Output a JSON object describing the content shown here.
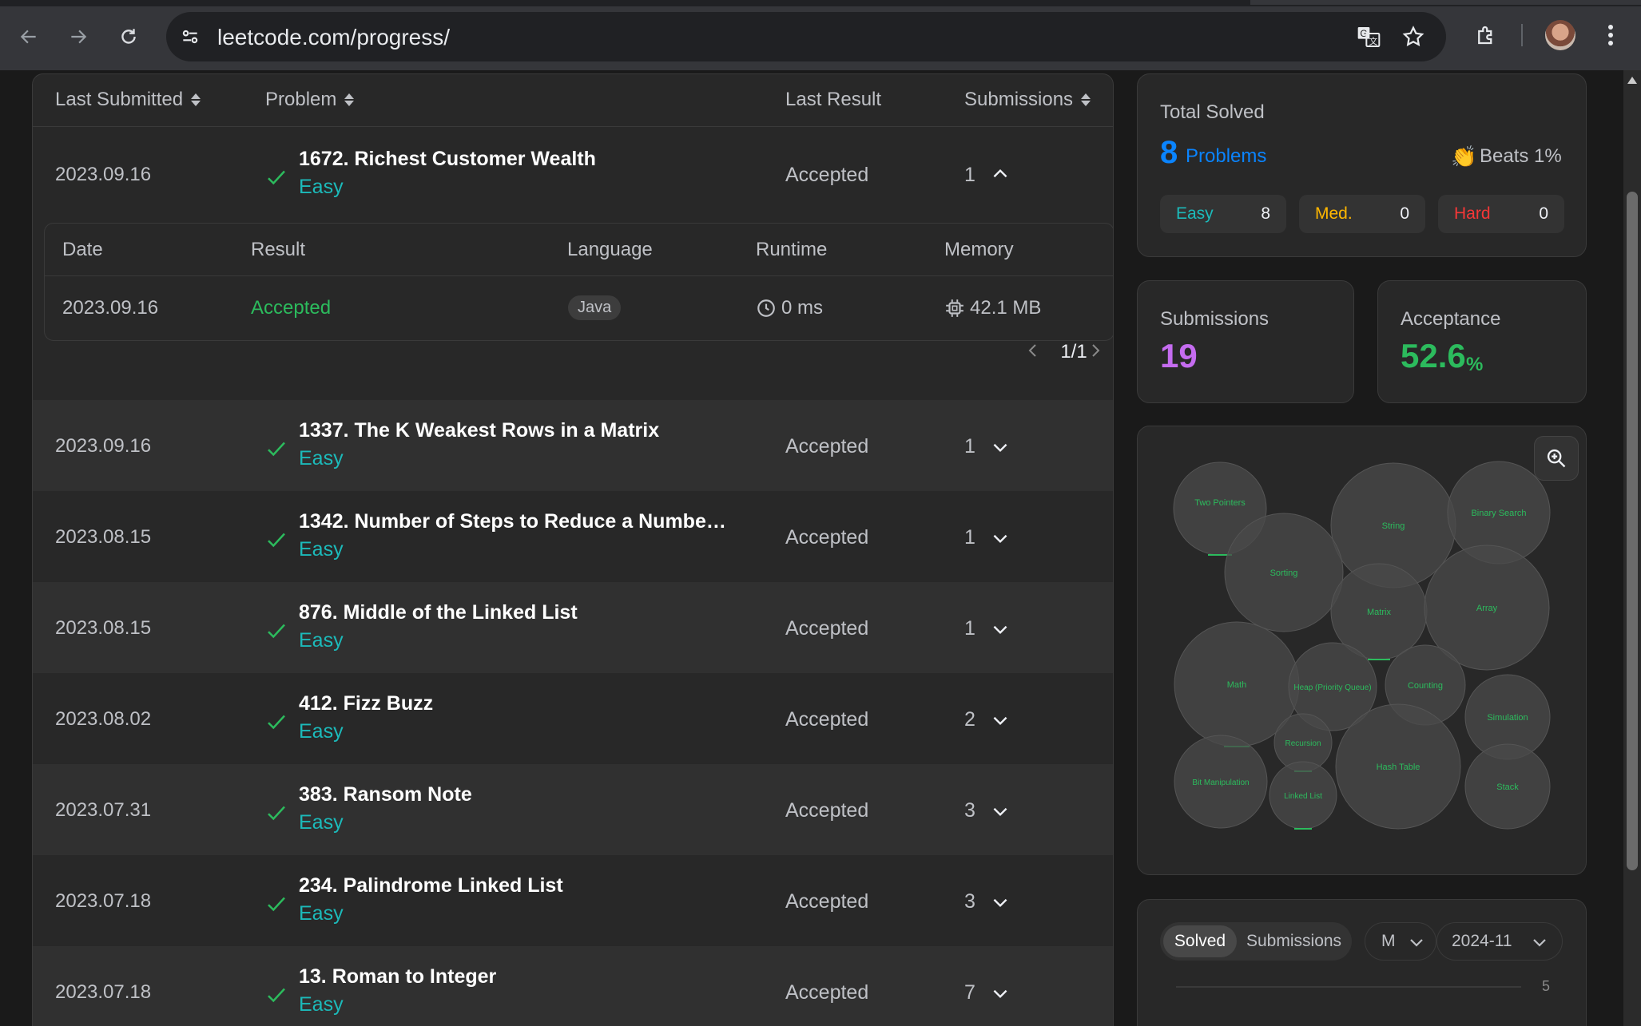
{
  "browser": {
    "url": "leetcode.com/progress/"
  },
  "table": {
    "headers": {
      "last_submitted": "Last Submitted",
      "problem": "Problem",
      "last_result": "Last Result",
      "submissions": "Submissions"
    },
    "rows": [
      {
        "date": "2023.09.16",
        "title": "1672. Richest Customer Wealth",
        "difficulty": "Easy",
        "result": "Accepted",
        "count": "1",
        "expanded": true
      },
      {
        "date": "2023.09.16",
        "title": "1337. The K Weakest Rows in a Matrix",
        "difficulty": "Easy",
        "result": "Accepted",
        "count": "1"
      },
      {
        "date": "2023.08.15",
        "title": "1342. Number of Steps to Reduce a Numbe…",
        "difficulty": "Easy",
        "result": "Accepted",
        "count": "1"
      },
      {
        "date": "2023.08.15",
        "title": "876. Middle of the Linked List",
        "difficulty": "Easy",
        "result": "Accepted",
        "count": "1"
      },
      {
        "date": "2023.08.02",
        "title": "412. Fizz Buzz",
        "difficulty": "Easy",
        "result": "Accepted",
        "count": "2"
      },
      {
        "date": "2023.07.31",
        "title": "383. Ransom Note",
        "difficulty": "Easy",
        "result": "Accepted",
        "count": "3"
      },
      {
        "date": "2023.07.18",
        "title": "234. Palindrome Linked List",
        "difficulty": "Easy",
        "result": "Accepted",
        "count": "3"
      },
      {
        "date": "2023.07.18",
        "title": "13. Roman to Integer",
        "difficulty": "Easy",
        "result": "Accepted",
        "count": "7"
      }
    ],
    "detail": {
      "headers": {
        "date": "Date",
        "result": "Result",
        "language": "Language",
        "runtime": "Runtime",
        "memory": "Memory"
      },
      "date": "2023.09.16",
      "result": "Accepted",
      "language": "Java",
      "runtime": "0 ms",
      "memory": "42.1 MB",
      "page": "1/1"
    }
  },
  "stats": {
    "total_solved_label": "Total Solved",
    "solved_count": "8",
    "solved_unit": "Problems",
    "beats": "Beats 1%",
    "easy": {
      "label": "Easy",
      "count": "8"
    },
    "medium": {
      "label": "Med.",
      "count": "0"
    },
    "hard": {
      "label": "Hard",
      "count": "0"
    },
    "submissions_label": "Submissions",
    "submissions_count": "19",
    "acceptance_label": "Acceptance",
    "acceptance_value": "52.6",
    "acceptance_unit": "%"
  },
  "topics": [
    {
      "label": "Two Pointers"
    },
    {
      "label": "String"
    },
    {
      "label": "Binary Search"
    },
    {
      "label": "Sorting"
    },
    {
      "label": "Matrix"
    },
    {
      "label": "Array"
    },
    {
      "label": "Math"
    },
    {
      "label": "Heap (Priority Queue)"
    },
    {
      "label": "Counting"
    },
    {
      "label": "Simulation"
    },
    {
      "label": "Recursion"
    },
    {
      "label": "Bit Manipulation"
    },
    {
      "label": "Linked List"
    },
    {
      "label": "Hash Table"
    },
    {
      "label": "Stack"
    }
  ],
  "calendar": {
    "tab_solved": "Solved",
    "tab_submissions": "Submissions",
    "period": "M",
    "month": "2024-11",
    "axis_tick": "5"
  },
  "colors": {
    "easy": "#1cbaba",
    "medium": "#ffb700",
    "hard": "#f63737",
    "accent_blue": "#0a84ff",
    "accepted": "#2cbb5d",
    "submissions_purple": "#c56cf0"
  }
}
